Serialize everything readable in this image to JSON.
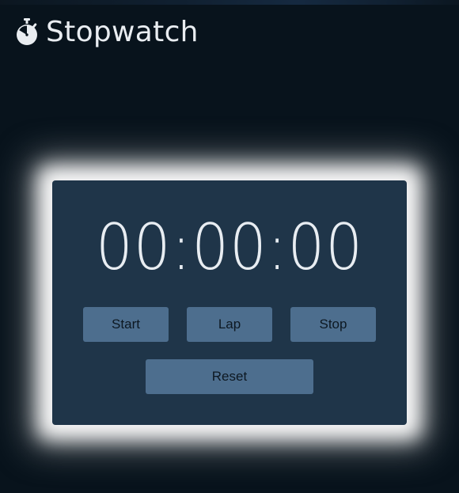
{
  "app": {
    "title": "Stopwatch",
    "icon": "stopwatch-icon"
  },
  "timer": {
    "display": "00:00:00"
  },
  "controls": {
    "start_label": "Start",
    "lap_label": "Lap",
    "stop_label": "Stop",
    "reset_label": "Reset"
  },
  "colors": {
    "background": "#08131c",
    "card": "#1f3549",
    "button": "#4d6e8e",
    "text_light": "#e9edf1"
  }
}
